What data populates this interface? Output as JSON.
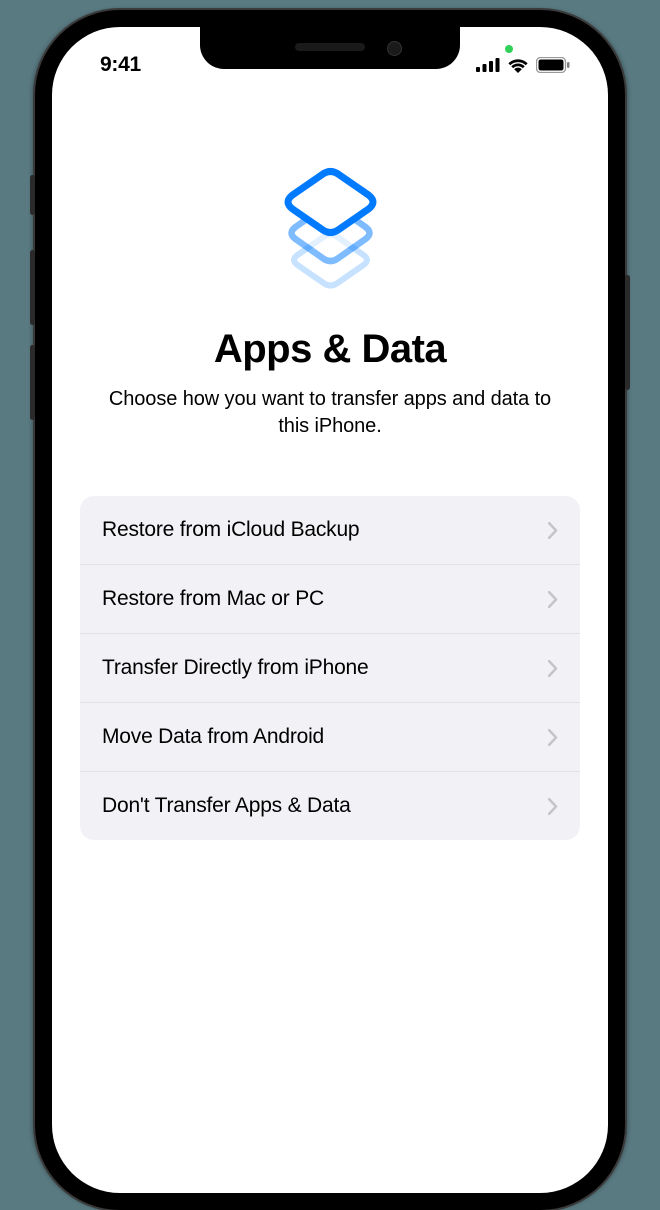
{
  "status": {
    "time": "9:41"
  },
  "page": {
    "title": "Apps & Data",
    "subtitle": "Choose how you want to transfer apps and data to this iPhone."
  },
  "options": [
    {
      "label": "Restore from iCloud Backup"
    },
    {
      "label": "Restore from Mac or PC"
    },
    {
      "label": "Transfer Directly from iPhone"
    },
    {
      "label": "Move Data from Android"
    },
    {
      "label": "Don't Transfer Apps & Data"
    }
  ]
}
